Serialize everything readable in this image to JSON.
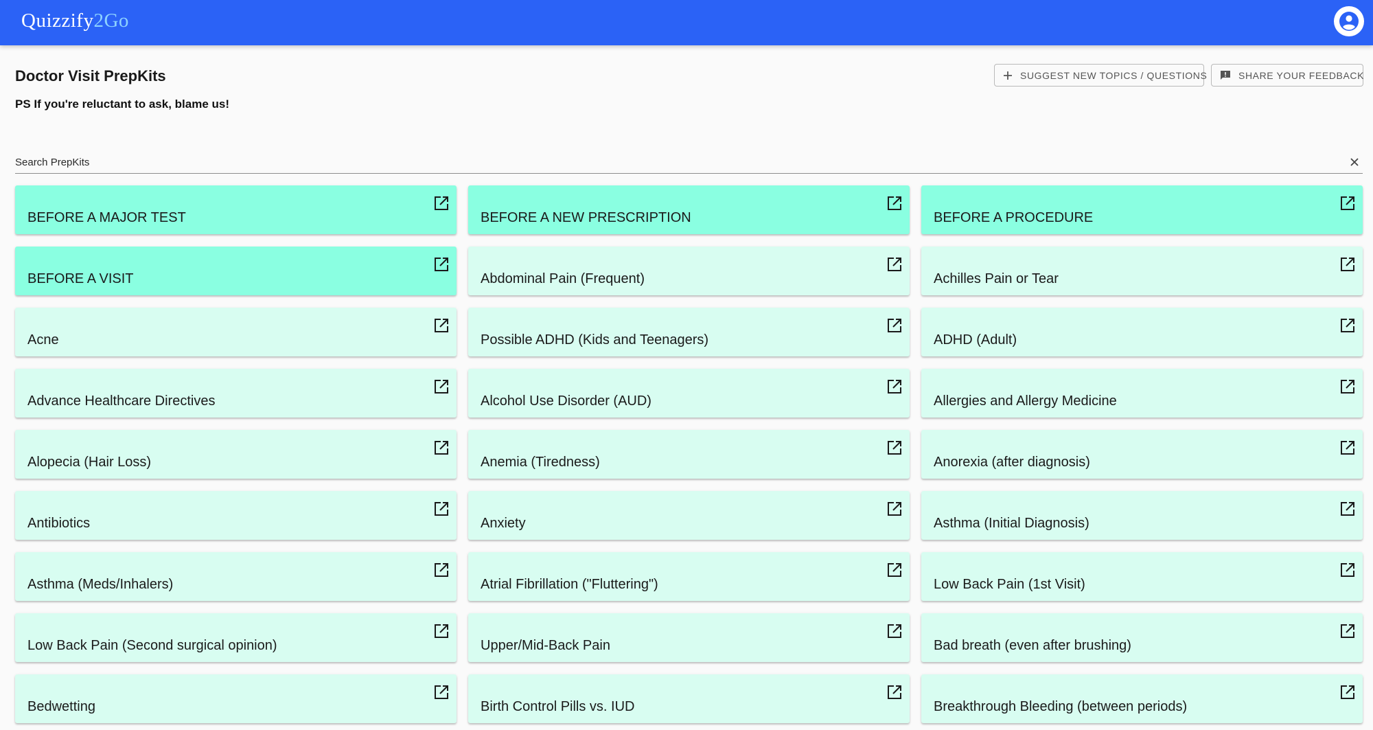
{
  "app": {
    "brand_part1": "Quizzify",
    "brand_part2": "2Go",
    "account_icon": "account-circle-icon"
  },
  "header": {
    "title": "Doctor Visit PrepKits",
    "subtitle": "PS If you're reluctant to ask, blame us!"
  },
  "actions": {
    "suggest_label": "Suggest new topics / questions",
    "suggest_icon": "plus-icon",
    "feedback_label": "Share your feedback",
    "feedback_icon": "feedback-icon"
  },
  "search": {
    "placeholder": "Search PrepKits",
    "value": "",
    "clear_icon": "close-icon"
  },
  "colors": {
    "topbar": "#2b62f6",
    "featured_card": "#8affe1",
    "card": "#d8fdf1"
  },
  "cards": [
    {
      "label": "BEFORE A MAJOR TEST",
      "featured": true
    },
    {
      "label": "BEFORE A NEW PRESCRIPTION",
      "featured": true
    },
    {
      "label": "BEFORE A PROCEDURE",
      "featured": true
    },
    {
      "label": "BEFORE A VISIT",
      "featured": true
    },
    {
      "label": "Abdominal Pain (Frequent)",
      "featured": false
    },
    {
      "label": "Achilles Pain or Tear",
      "featured": false
    },
    {
      "label": "Acne",
      "featured": false
    },
    {
      "label": "Possible ADHD (Kids and Teenagers)",
      "featured": false
    },
    {
      "label": "ADHD (Adult)",
      "featured": false
    },
    {
      "label": "Advance Healthcare Directives",
      "featured": false
    },
    {
      "label": "Alcohol Use Disorder (AUD)",
      "featured": false
    },
    {
      "label": "Allergies and Allergy Medicine",
      "featured": false
    },
    {
      "label": "Alopecia (Hair Loss)",
      "featured": false
    },
    {
      "label": "Anemia (Tiredness)",
      "featured": false
    },
    {
      "label": "Anorexia (after diagnosis)",
      "featured": false
    },
    {
      "label": "Antibiotics",
      "featured": false
    },
    {
      "label": "Anxiety",
      "featured": false
    },
    {
      "label": "Asthma (Initial Diagnosis)",
      "featured": false
    },
    {
      "label": "Asthma (Meds/Inhalers)",
      "featured": false
    },
    {
      "label": "Atrial Fibrillation (\"Fluttering\")",
      "featured": false
    },
    {
      "label": "Low Back Pain (1st Visit)",
      "featured": false
    },
    {
      "label": "Low Back Pain (Second surgical opinion)",
      "featured": false
    },
    {
      "label": "Upper/Mid-Back Pain",
      "featured": false
    },
    {
      "label": "Bad breath (even after brushing)",
      "featured": false
    },
    {
      "label": "Bedwetting",
      "featured": false
    },
    {
      "label": "Birth Control Pills vs. IUD",
      "featured": false
    },
    {
      "label": "Breakthrough Bleeding (between periods)",
      "featured": false
    }
  ]
}
